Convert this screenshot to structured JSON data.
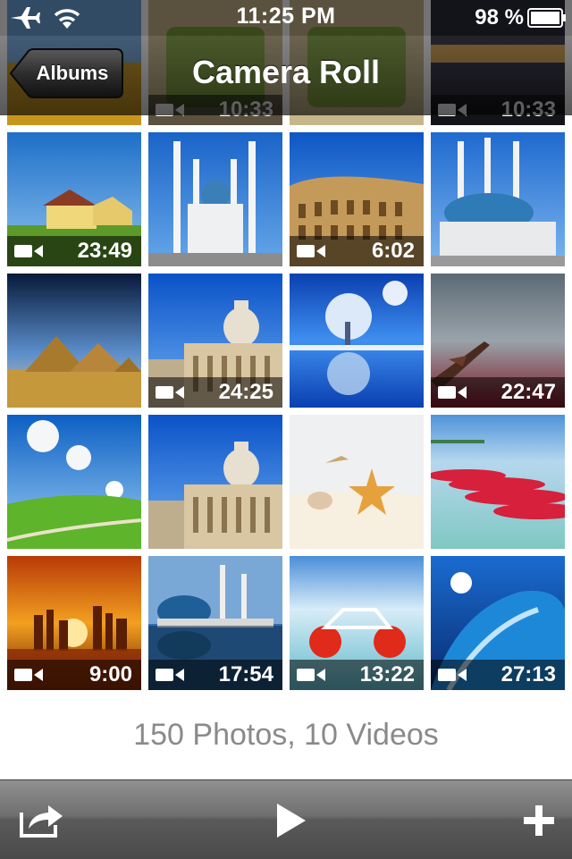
{
  "status_bar": {
    "time": "11:25 PM",
    "battery": "98 %",
    "icons": [
      "airplane-icon",
      "wifi-icon",
      "battery-icon"
    ]
  },
  "nav": {
    "title": "Camera Roll",
    "back_label": "Albums"
  },
  "top_partial_row": [
    {
      "scene": "wheat-field",
      "video": false,
      "duration": ""
    },
    {
      "scene": "tea-glass",
      "video": true,
      "duration": "10:33"
    },
    {
      "scene": "tea-glass",
      "video": false,
      "duration": ""
    },
    {
      "scene": "sunset-city",
      "video": true,
      "duration": "10:33"
    }
  ],
  "grid": [
    {
      "scene": "country-house",
      "video": true,
      "duration": "23:49"
    },
    {
      "scene": "white-mosque",
      "video": false,
      "duration": ""
    },
    {
      "scene": "colosseum",
      "video": true,
      "duration": "6:02"
    },
    {
      "scene": "blue-mosque",
      "video": false,
      "duration": ""
    },
    {
      "scene": "pyramids",
      "video": false,
      "duration": ""
    },
    {
      "scene": "st-peters",
      "video": true,
      "duration": "24:25"
    },
    {
      "scene": "frost-tree",
      "video": false,
      "duration": ""
    },
    {
      "scene": "airplane-red-sky",
      "video": true,
      "duration": "22:47"
    },
    {
      "scene": "green-hills",
      "video": false,
      "duration": ""
    },
    {
      "scene": "st-peters",
      "video": false,
      "duration": ""
    },
    {
      "scene": "starfish-beach",
      "video": false,
      "duration": ""
    },
    {
      "scene": "red-kayaks",
      "video": false,
      "duration": ""
    },
    {
      "scene": "city-sunset",
      "video": true,
      "duration": "9:00"
    },
    {
      "scene": "mosque-reflection",
      "video": true,
      "duration": "17:54"
    },
    {
      "scene": "red-pedal-boat",
      "video": true,
      "duration": "13:22"
    },
    {
      "scene": "blue-wave",
      "video": true,
      "duration": "27:13"
    }
  ],
  "summary": "150 Photos, 10 Videos",
  "toolbar": {
    "icons": [
      "share-icon",
      "play-icon",
      "add-icon"
    ]
  }
}
